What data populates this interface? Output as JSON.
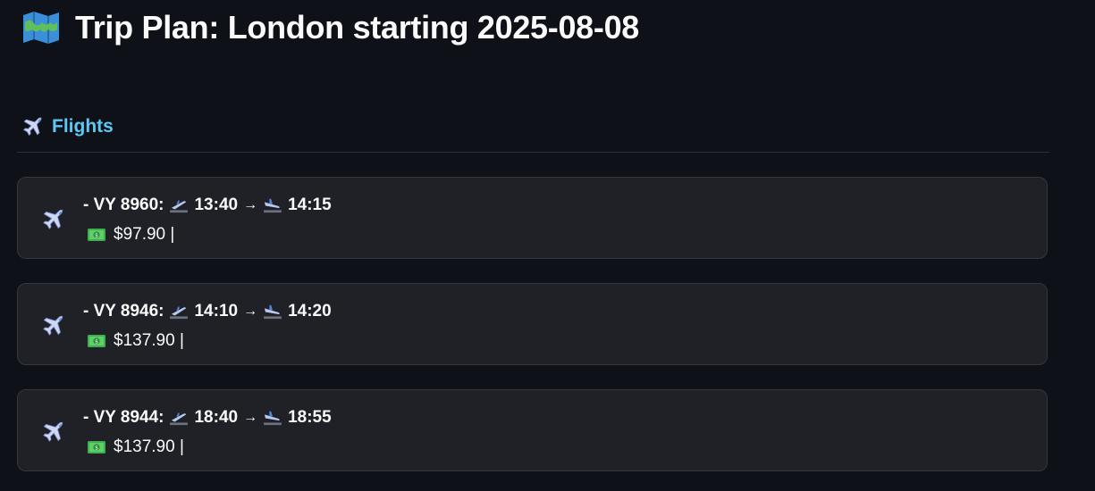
{
  "header": {
    "title": "Trip Plan: London starting 2025-08-08",
    "title_icon": "map-icon"
  },
  "flights_section": {
    "title": "Flights",
    "title_icon": "airplane-icon"
  },
  "flights": [
    {
      "prefix": "- VY 8960:",
      "departure_time": "13:40",
      "arrow": "→",
      "arrival_time": "14:15",
      "price": "$97.90 |"
    },
    {
      "prefix": "- VY 8946:",
      "departure_time": "14:10",
      "arrow": "→",
      "arrival_time": "14:20",
      "price": "$137.90 |"
    },
    {
      "prefix": "- VY 8944:",
      "departure_time": "18:40",
      "arrow": "→",
      "arrival_time": "18:55",
      "price": "$137.90 |"
    }
  ],
  "icons": {
    "card_icon": "airplane-icon",
    "departure_icon": "airplane-departure-icon",
    "arrival_icon": "airplane-arrival-icon",
    "price_icon": "dollar-banknote-icon"
  },
  "colors": {
    "background": "#0e1117",
    "card_background": "#1f2127",
    "section_title": "#5cc8f5",
    "text": "#fafafa"
  }
}
